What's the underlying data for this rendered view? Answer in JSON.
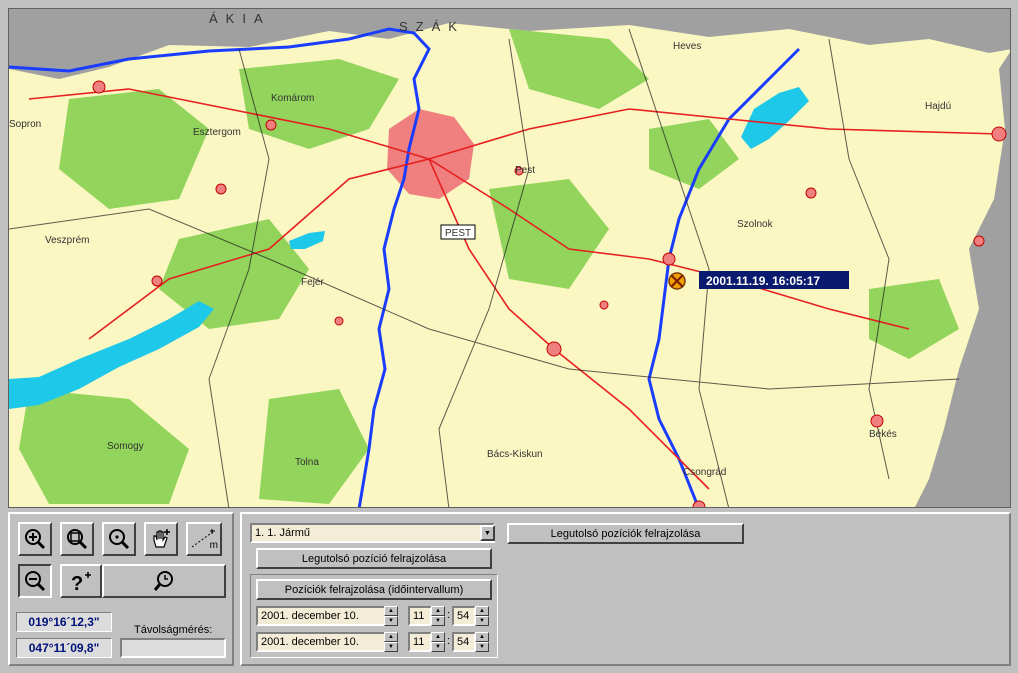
{
  "map": {
    "labels": [
      "ÁKIA",
      "SZÁK",
      "Heves",
      "Komárom",
      "Esztergom",
      "Sopron",
      "Veszprém",
      "Fejér",
      "Pest",
      "Szolnok",
      "Hajdú",
      "Somogy",
      "Tolna",
      "Bács-Kiskun",
      "Csongrád",
      "Békés"
    ],
    "pest_label": "PEST",
    "marker_timestamp": "2001.11.19. 16:05:17",
    "colors": {
      "water": "#1ec8e8",
      "land": "#fbf7c2",
      "neighbor": "#a0a0a0",
      "forest": "#6fc83a",
      "urban": "#f08080",
      "highway": "#e62020",
      "border": "#1a1a1a",
      "marker": "#f0a000",
      "timestamp_bg": "#0a1a6e"
    }
  },
  "toolbar": {
    "zoom_in_icon": "zoom-in-icon",
    "zoom_window_icon": "zoom-window-icon",
    "zoom_center_icon": "zoom-center-icon",
    "pan_icon": "pan-hand-icon",
    "measure_icon": "measure-icon",
    "zoom_out_icon": "zoom-out-icon",
    "info_icon": "info-icon",
    "zoom_all_icon": "zoom-full-icon",
    "measure_unit": "m"
  },
  "coordinates": {
    "longitude": "019°16´12,3\"",
    "latitude": "047°11´09,8\""
  },
  "distance": {
    "label": "Távolságmérés:",
    "value": ""
  },
  "vehicle": {
    "selected": "1. 1. Jármű"
  },
  "buttons": {
    "last_positions": "Legutolsó pozíciók felrajzolása",
    "last_position": "Legutolsó pozíció felrajzolása",
    "positions_interval": "Pozíciók felrajzolása (időintervallum)"
  },
  "interval": {
    "from": {
      "date": "2001. december 10.",
      "hour": "11",
      "minute": "54"
    },
    "to": {
      "date": "2001. december 10.",
      "hour": "11",
      "minute": "54"
    }
  }
}
